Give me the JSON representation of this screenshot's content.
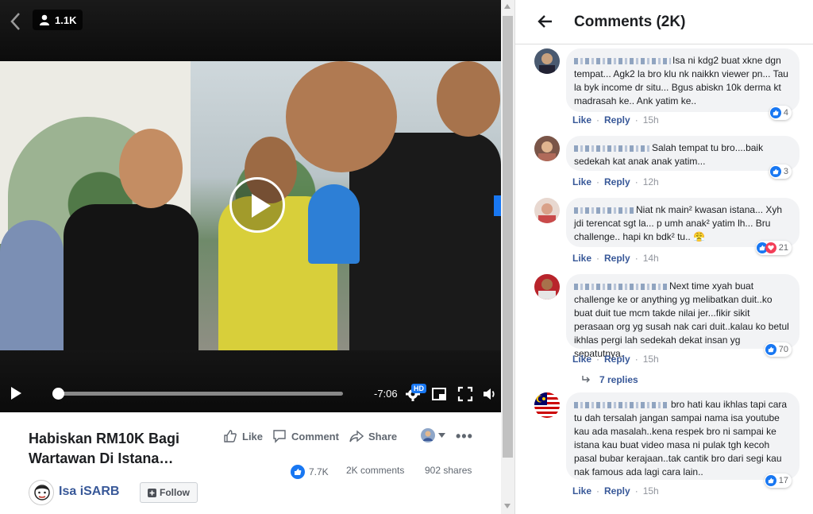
{
  "video": {
    "viewer_count": "1.1K",
    "time_remaining": "-7:06",
    "hd_label": "HD",
    "progress": 0.01
  },
  "post": {
    "title": "Habiskan RM10K Bagi Wartawan Di Istana…",
    "actions": {
      "like": "Like",
      "comment": "Comment",
      "share": "Share",
      "more": "•••"
    },
    "stats": {
      "reactions": "7.7K",
      "comments": "2K comments",
      "shares": "902 shares"
    },
    "page_name": "Isa iSARB",
    "follow_label": "Follow"
  },
  "comments_panel": {
    "title": "Comments (2K)",
    "comments": [
      {
        "text": "Isa ni kdg2 buat xkne dgn tempat... Agk2 la bro klu nk naikkn viewer pn... Tau la byk income dr situ... Bgus abiskn 10k derma kt madrasah ke.. Ank yatim ke..",
        "reactions": "4",
        "like": "Like",
        "reply": "Reply",
        "time": "15h"
      },
      {
        "text": "Salah tempat tu bro....baik sedekah kat anak anak yatim...",
        "reactions": "3",
        "like": "Like",
        "reply": "Reply",
        "time": "12h"
      },
      {
        "text": "Niat nk main² kwasan istana... Xyh jdi terencat sgt la... p umh anak² yatim lh... Bru challenge.. hapi kn bdk² tu.. 😤",
        "reactions": "21",
        "like": "Like",
        "reply": "Reply",
        "time": "14h"
      },
      {
        "text": "Next time xyah buat challenge ke or anything yg melibatkan duit..ko buat duit tue mcm takde nilai jer...fikir sikit perasaan org yg susah nak cari duit..kalau ko betul ikhlas pergi lah sedekah dekat insan yg sepatutnya.",
        "reactions": "70",
        "like": "Like",
        "reply": "Reply",
        "time": "15h",
        "replies": "7 replies"
      },
      {
        "text": "bro hati kau ikhlas tapi cara tu dah tersalah jangan sampai nama isa youtube kau ada masalah..kena respek bro ni sampai ke istana kau buat video masa ni pulak tgh kecoh pasal bubar kerajaan..tak cantik bro dari segi kau nak famous ada lagi cara lain..",
        "reactions": "17",
        "like": "Like",
        "reply": "Reply",
        "time": "15h"
      }
    ]
  },
  "colors": {
    "accent": "#1877f2",
    "link": "#385898",
    "bubble": "#f2f3f5",
    "love": "#f33e58"
  }
}
